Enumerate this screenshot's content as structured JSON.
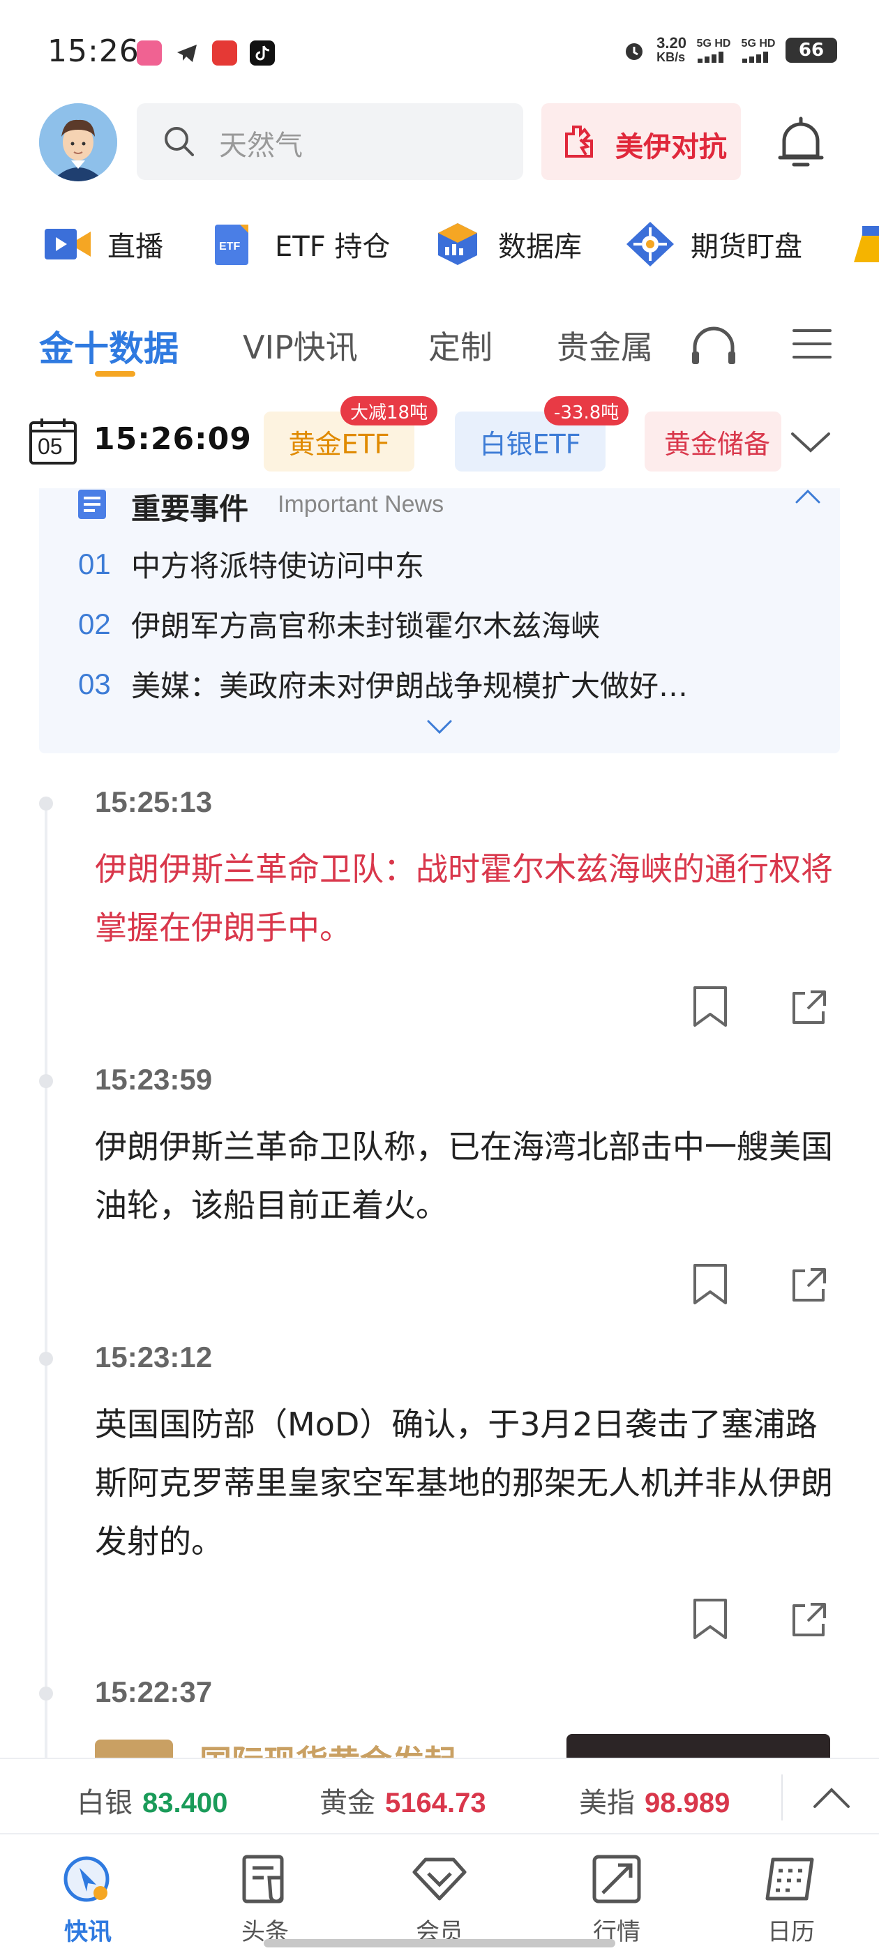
{
  "status_bar": {
    "time": "15:26",
    "net_speed": "3.20",
    "net_unit": "KB/s",
    "signal1": "5G HD",
    "signal2": "5G HD",
    "battery": "66"
  },
  "header": {
    "search_placeholder": "天然气",
    "promo_label": "美伊对抗"
  },
  "quick_entries": [
    {
      "label": "直播",
      "icon": "video-icon"
    },
    {
      "label": "ETF 持仓",
      "icon": "etf-icon"
    },
    {
      "label": "数据库",
      "icon": "database-icon"
    },
    {
      "label": "期货盯盘",
      "icon": "futures-icon"
    }
  ],
  "tabs": [
    {
      "label": "金十数据",
      "active": true
    },
    {
      "label": "VIP快讯"
    },
    {
      "label": "定制"
    },
    {
      "label": "贵金属"
    }
  ],
  "data_bar": {
    "calendar_day": "05",
    "time": "15:26:09",
    "pills": [
      {
        "label": "黄金ETF",
        "badge": "大减18吨"
      },
      {
        "label": "白银ETF",
        "badge": "-33.8吨"
      },
      {
        "label": "黄金储备",
        "badge": ""
      }
    ]
  },
  "important_news": {
    "title": "重要事件",
    "subtitle": "Important News",
    "items": [
      {
        "num": "01",
        "text": "中方将派特使访问中东"
      },
      {
        "num": "02",
        "text": "伊朗军方高官称未封锁霍尔木兹海峡"
      },
      {
        "num": "03",
        "text": "美媒：美政府未对伊朗战争规模扩大做好…"
      }
    ]
  },
  "feed": [
    {
      "time": "15:25:13",
      "text": "伊朗伊斯兰革命卫队：战时霍尔木兹海峡的通行权将掌握在伊朗手中。",
      "highlight": true
    },
    {
      "time": "15:23:59",
      "text": "伊朗伊斯兰革命卫队称，已在海湾北部击中一艘美国油轮，该船目前正着火。",
      "highlight": false
    },
    {
      "time": "15:23:12",
      "text": "英国国防部（MoD）确认，于3月2日袭击了塞浦路斯阿克罗蒂里皇家空军基地的那架无人机并非从伊朗发射的。",
      "highlight": false
    },
    {
      "time": "15:22:37",
      "text": "国际现货黄金发起",
      "highlight": false
    }
  ],
  "ticker": [
    {
      "name": "白银",
      "value": "83.400",
      "color": "#1a9b59"
    },
    {
      "name": "黄金",
      "value": "5164.73",
      "color": "#d9374b"
    },
    {
      "name": "美指",
      "value": "98.989",
      "color": "#d9374b"
    }
  ],
  "bottom_nav": [
    {
      "label": "快讯",
      "active": true,
      "icon": "flash-news-icon"
    },
    {
      "label": "头条",
      "icon": "headline-icon"
    },
    {
      "label": "会员",
      "icon": "member-icon"
    },
    {
      "label": "行情",
      "icon": "market-icon"
    },
    {
      "label": "日历",
      "icon": "calendar-icon"
    }
  ],
  "colors": {
    "accent_blue": "#2f7ae0",
    "alert_red": "#d9374b",
    "up_green": "#1a9b59",
    "tab_underline": "#f5a623"
  }
}
